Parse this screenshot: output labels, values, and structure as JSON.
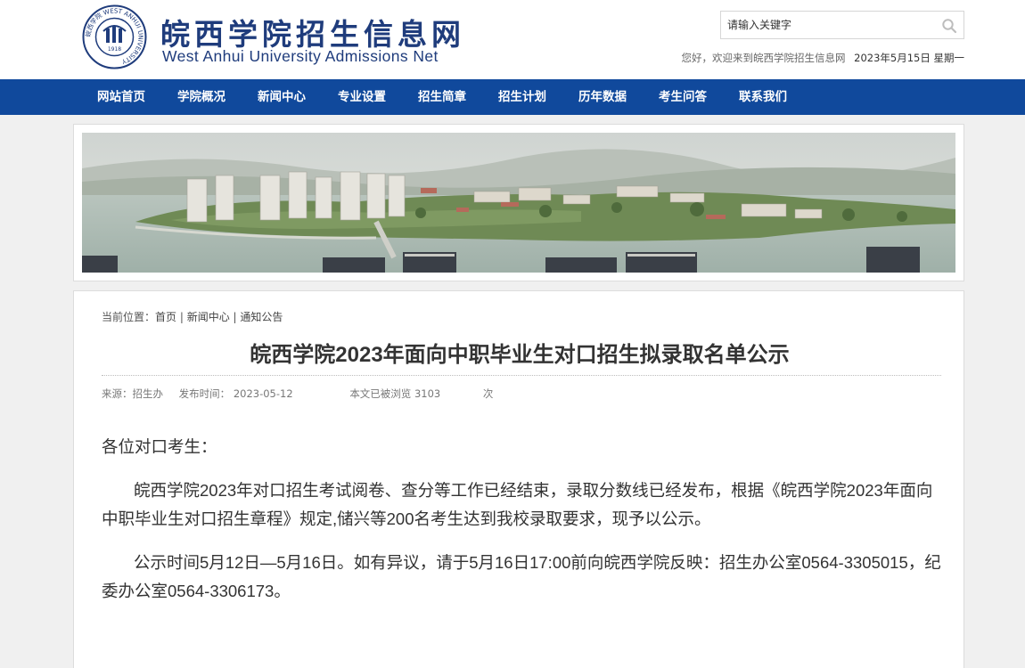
{
  "header": {
    "logo_year": "1918",
    "logo_ring_text": "皖西学院 WEST ANHUI UNIVERSITY",
    "brand_cn": "皖西学院招生信息网",
    "brand_en": "West Anhui University Admissions Net",
    "search_placeholder": "请输入关键字",
    "greeting": "您好，欢迎来到皖西学院招生信息网",
    "date": "2023年5月15日 星期一"
  },
  "nav": {
    "items": [
      "网站首页",
      "学院概况",
      "新闻中心",
      "专业设置",
      "招生简章",
      "招生计划",
      "历年数据",
      "考生问答",
      "联系我们"
    ]
  },
  "breadcrumb": {
    "prefix": "当前位置：",
    "items": [
      "首页",
      "新闻中心",
      "通知公告"
    ],
    "separator": " | "
  },
  "article": {
    "title": "皖西学院2023年面向中职毕业生对口招生拟录取名单公示",
    "source": "来源：招生办",
    "publish_label": "发布时间：",
    "publish_date": "2023-05-12",
    "views_label": "本文已被浏览 3103",
    "views_unit": "次",
    "paragraphs": [
      "各位对口考生：",
      "皖西学院2023年对口招生考试阅卷、查分等工作已经结束，录取分数线已经发布，根据《皖西学院2023年面向中职毕业生对口招生章程》规定,储兴等200名考生达到我校录取要求，现予以公示。",
      "公示时间5月12日—5月16日。如有异议，请于5月16日17:00前向皖西学院反映：招生办公室0564-3305015，纪委办公室0564-3306173。"
    ]
  },
  "colors": {
    "nav_bg": "#10499c",
    "brand": "#1f3c7c",
    "page_bg": "#f0f0f0"
  },
  "icons": {
    "search": "search-icon",
    "logo": "university-seal-logo"
  }
}
